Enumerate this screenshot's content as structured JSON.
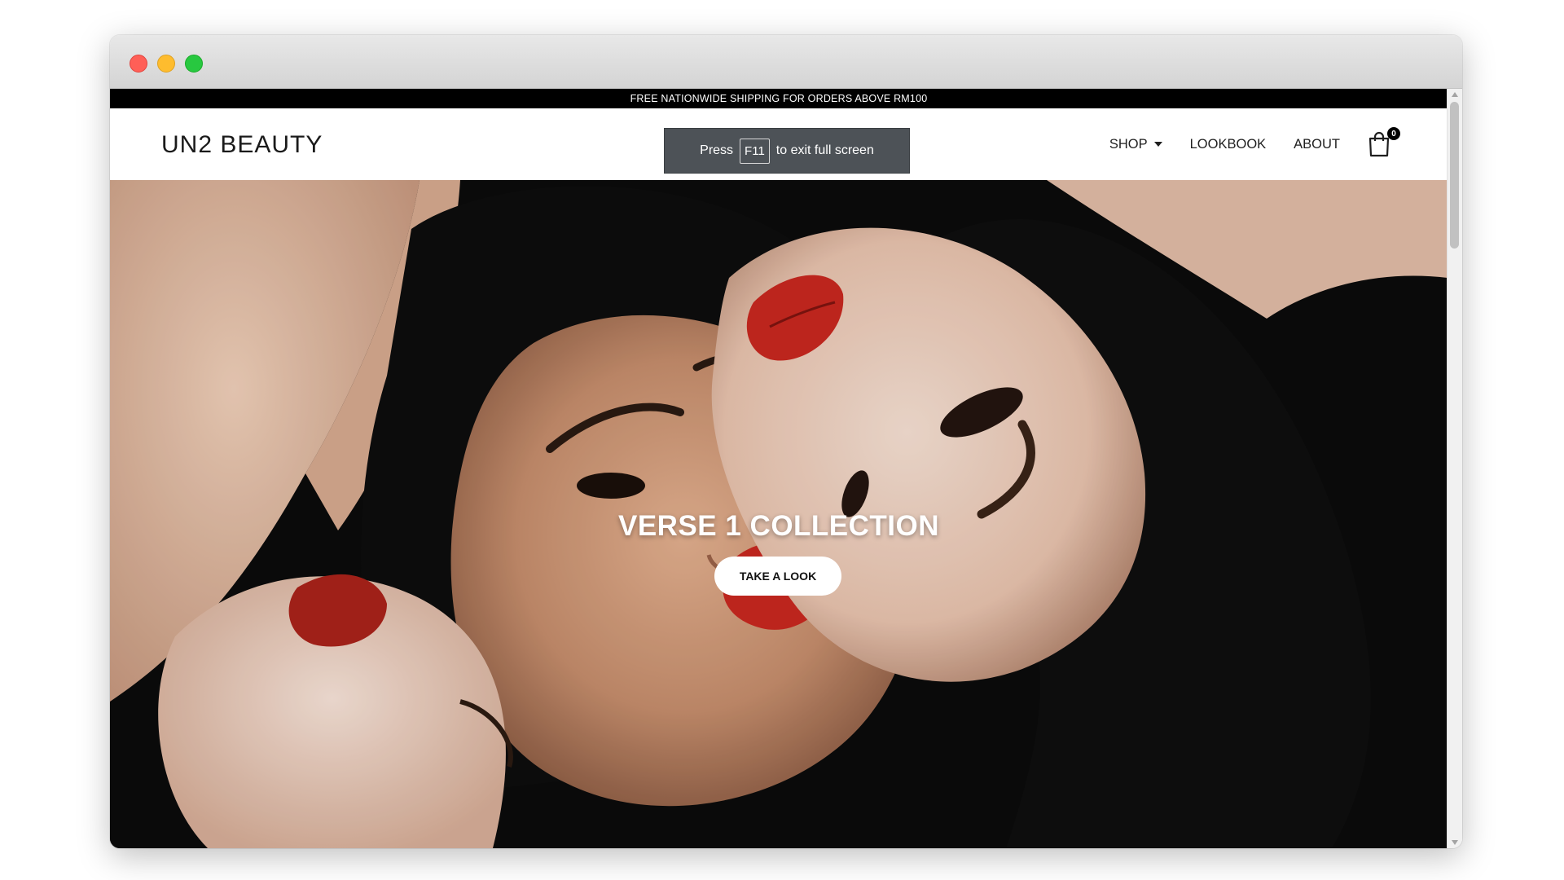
{
  "announcement": "FREE NATIONWIDE SHIPPING FOR ORDERS ABOVE RM100",
  "brand": {
    "logo_text": "UN2 BEAUTY"
  },
  "nav": {
    "shop": "SHOP",
    "lookbook": "LOOKBOOK",
    "about": "ABOUT",
    "cart_count": "0"
  },
  "fullscreen_toast": {
    "prefix": "Press",
    "key": "F11",
    "suffix": "to exit full screen"
  },
  "hero": {
    "title": "VERSE 1 COLLECTION",
    "cta": "TAKE A LOOK"
  },
  "colors": {
    "announcement_bg": "#000000",
    "lip_red": "#c8281f",
    "skin_tone": "#d9a384",
    "hair": "#0b0b0b"
  }
}
